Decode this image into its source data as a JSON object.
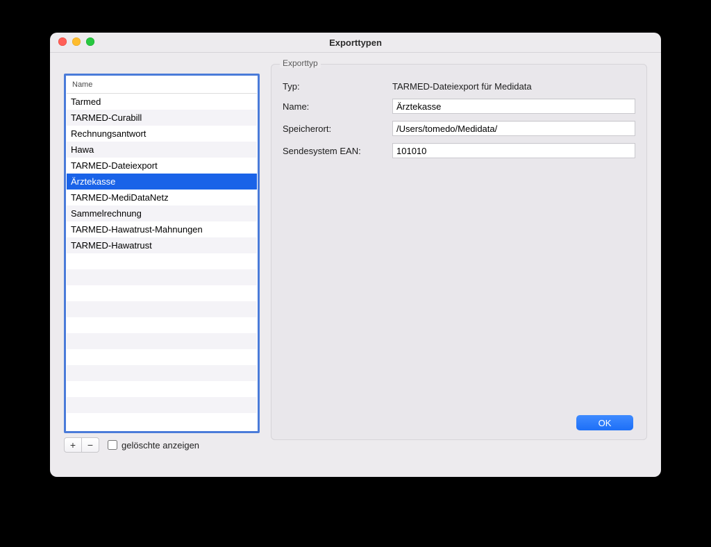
{
  "window": {
    "title": "Exporttypen"
  },
  "list": {
    "header": "Name",
    "selected_index": 5,
    "items": [
      "Tarmed",
      "TARMED-Curabill",
      "Rechnungsantwort",
      "Hawa",
      "TARMED-Dateiexport",
      "Ärztekasse",
      "TARMED-MediDataNetz",
      "Sammelrechnung",
      "TARMED-Hawatrust-Mahnungen",
      "TARMED-Hawatrust"
    ]
  },
  "footer": {
    "add_label": "+",
    "remove_label": "−",
    "show_deleted_label": "gelöschte anzeigen",
    "show_deleted_checked": false
  },
  "detail": {
    "group_label": "Exporttyp",
    "labels": {
      "typ": "Typ:",
      "name": "Name:",
      "speicherort": "Speicherort:",
      "sendesystem": "Sendesystem EAN:"
    },
    "values": {
      "typ": "TARMED-Dateiexport für Medidata",
      "name": "Ärztekasse",
      "speicherort": "/Users/tomedo/Medidata/",
      "sendesystem": "101010"
    }
  },
  "actions": {
    "ok": "OK"
  }
}
